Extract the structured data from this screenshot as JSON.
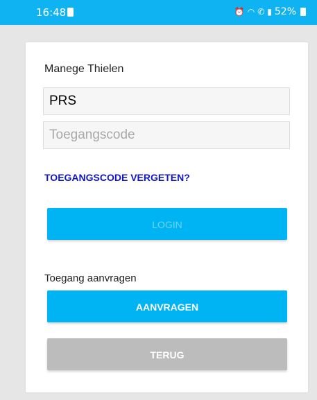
{
  "status_bar": {
    "time": "16:48",
    "battery_percent": "52%",
    "background_color": "#10b3f1",
    "icons": [
      "battery-icon",
      "alarm-icon",
      "wifi-icon",
      "wifi-calling-icon",
      "signal-icon",
      "battery-icon"
    ]
  },
  "login": {
    "club_name": "Manege Thielen",
    "username_value": "PRS",
    "access_code_placeholder": "Toegangscode",
    "forgot_link": "TOEGANGSCODE VERGETEN?",
    "login_button": "LOGIN"
  },
  "request": {
    "label": "Toegang aanvragen",
    "request_button": "AANVRAGEN",
    "back_button": "TERUG"
  },
  "colors": {
    "accent": "#00b4f4",
    "link": "#0f16c4",
    "disabled_button": "#bcbcbc"
  }
}
